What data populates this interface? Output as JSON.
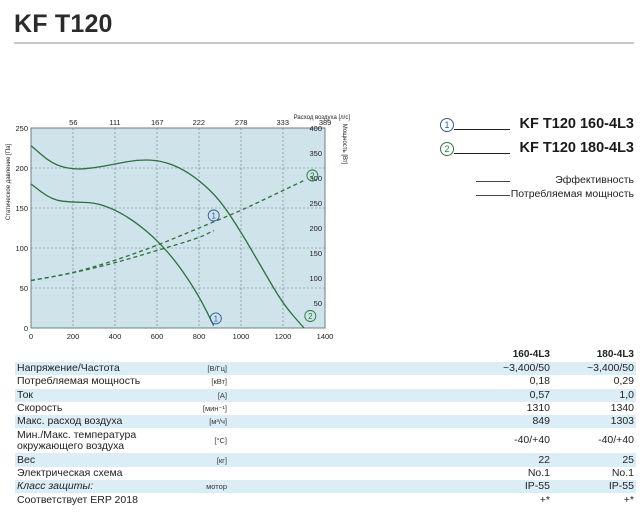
{
  "title": "KF T120",
  "chart": {
    "top_axis_title": "Расход воздуха [л/с]",
    "top_ticks": [
      "56",
      "111",
      "167",
      "222",
      "278",
      "333",
      "389"
    ],
    "left_axis_title": "Статическое давление [Па]",
    "left_ticks": [
      "0",
      "50",
      "100",
      "150",
      "200",
      "250"
    ],
    "right_axis_title": "Мощность [Вт]",
    "right_ticks": [
      "50",
      "100",
      "150",
      "200",
      "250",
      "300",
      "350",
      "400"
    ],
    "bottom_axis_title": "Расход воздуха [м³/ч]",
    "bottom_ticks": [
      "0",
      "200",
      "400",
      "600",
      "800",
      "1000",
      "1200",
      "1400"
    ],
    "markers": [
      "1",
      "2",
      "1",
      "2"
    ],
    "colors": {
      "background": "#cfe3ea",
      "grid": "#6d7f86",
      "pressure": "#2f6f3f",
      "power": "#2f6f3f"
    }
  },
  "chart_data": {
    "type": "line",
    "xlabel": "Расход воздуха [м³/ч]",
    "ylabel": "Статическое давление [Па]",
    "y2label": "Мощность [Вт]",
    "x2label": "Расход воздуха [л/с]",
    "xlim": [
      0,
      1400
    ],
    "ylim": [
      0,
      250
    ],
    "y2lim": [
      0,
      400
    ],
    "grid": true,
    "series": [
      {
        "name": "1",
        "kind": "pressure",
        "x": [
          0,
          100,
          200,
          300,
          400,
          500,
          600,
          700,
          800,
          870
        ],
        "y": [
          180,
          160,
          157,
          157,
          148,
          132,
          110,
          80,
          40,
          3
        ]
      },
      {
        "name": "2",
        "kind": "pressure",
        "x": [
          0,
          100,
          200,
          300,
          400,
          500,
          600,
          700,
          800,
          900,
          1000,
          1100,
          1200,
          1300
        ],
        "y": [
          228,
          205,
          198,
          200,
          205,
          210,
          210,
          202,
          185,
          160,
          120,
          75,
          30,
          0
        ]
      },
      {
        "name": "1",
        "kind": "power",
        "x": [
          0,
          200,
          400,
          600,
          800,
          870
        ],
        "y": [
          95,
          110,
          130,
          155,
          180,
          195
        ]
      },
      {
        "name": "2",
        "kind": "power",
        "x": [
          0,
          200,
          400,
          600,
          800,
          1000,
          1100,
          1200,
          1300
        ],
        "y": [
          95,
          110,
          135,
          165,
          200,
          235,
          255,
          275,
          295
        ]
      }
    ]
  },
  "models": [
    {
      "num": "1",
      "label": "KF T120 160-4L3",
      "color": "#2d5aa0"
    },
    {
      "num": "2",
      "label": "KF T120 180-4L3",
      "color": "#2f7a44"
    }
  ],
  "legend": [
    {
      "label": "Эффективность"
    },
    {
      "label": "Потребляемая мощность"
    }
  ],
  "table": {
    "headers": [
      "160-4L3",
      "180-4L3"
    ],
    "rows": [
      {
        "name": "Напряжение/Частота",
        "unit": "[В/Гц]",
        "v1": "~3,400/50",
        "v2": "~3,400/50",
        "blue": true
      },
      {
        "name": "Потребляемая мощность",
        "unit": "[кВт]",
        "v1": "0,18",
        "v2": "0,29",
        "blue": false
      },
      {
        "name": "Ток",
        "unit": "[А]",
        "v1": "0,57",
        "v2": "1,0",
        "blue": true
      },
      {
        "name": "Скорость",
        "unit": "[мин⁻¹]",
        "v1": "1310",
        "v2": "1340",
        "blue": false
      },
      {
        "name": "Макс. расход воздуха",
        "unit": "[м³/ч]",
        "v1": "849",
        "v2": "1303",
        "blue": true
      },
      {
        "name": "Мин./Макс. температура окружающего воздуха",
        "unit": "[°С]",
        "v1": "-40/+40",
        "v2": "-40/+40",
        "blue": false
      },
      {
        "name": "Вес",
        "unit": "[кг]",
        "v1": "22",
        "v2": "25",
        "blue": true
      },
      {
        "name": "Электрическая схема",
        "unit": "",
        "v1": "No.1",
        "v2": "No.1",
        "blue": false
      },
      {
        "name": "Класс защиты:",
        "unit": "мотор",
        "v1": "IP-55",
        "v2": "IP-55",
        "blue": true
      },
      {
        "name": "Соответствует ERP 2018",
        "unit": "",
        "v1": "+*",
        "v2": "+*",
        "blue": false
      }
    ]
  }
}
